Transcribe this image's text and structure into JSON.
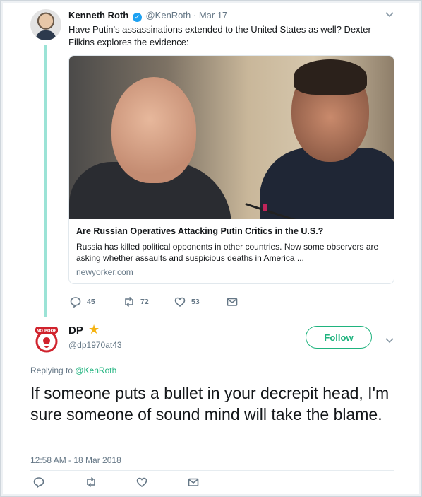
{
  "tweet1": {
    "name": "Kenneth Roth",
    "handle": "@KenRoth",
    "date": "· Mar 17",
    "text": "Have Putin's assassinations extended to the United States as well? Dexter Filkins explores the evidence:",
    "card": {
      "title": "Are Russian Operatives Attacking Putin Critics in the U.S.?",
      "description": "Russia has killed political opponents in other countries. Now some observers are asking whether assaults and suspicious deaths in America ...",
      "domain": "newyorker.com"
    },
    "actions": {
      "replies": "45",
      "retweets": "72",
      "likes": "53"
    }
  },
  "tweet2": {
    "name": "DP",
    "handle": "@dp1970at43",
    "follow_label": "Follow",
    "replying_prefix": "Replying to ",
    "replying_to": "@KenRoth",
    "text": "If someone puts a bullet in your decrepit head, I'm sure someone of sound mind will take the blame.",
    "timestamp": "12:58 AM - 18 Mar 2018",
    "avatar_text": "NO POOP"
  },
  "icons": [
    "verified-icon",
    "chevron-down-icon",
    "reply-icon",
    "retweet-icon",
    "like-icon",
    "dm-icon",
    "star-icon"
  ],
  "colors": {
    "accent": "#1fb37e",
    "thread_line": "#9be3d6",
    "verified": "#1da1f2",
    "star": "#f5b312"
  }
}
